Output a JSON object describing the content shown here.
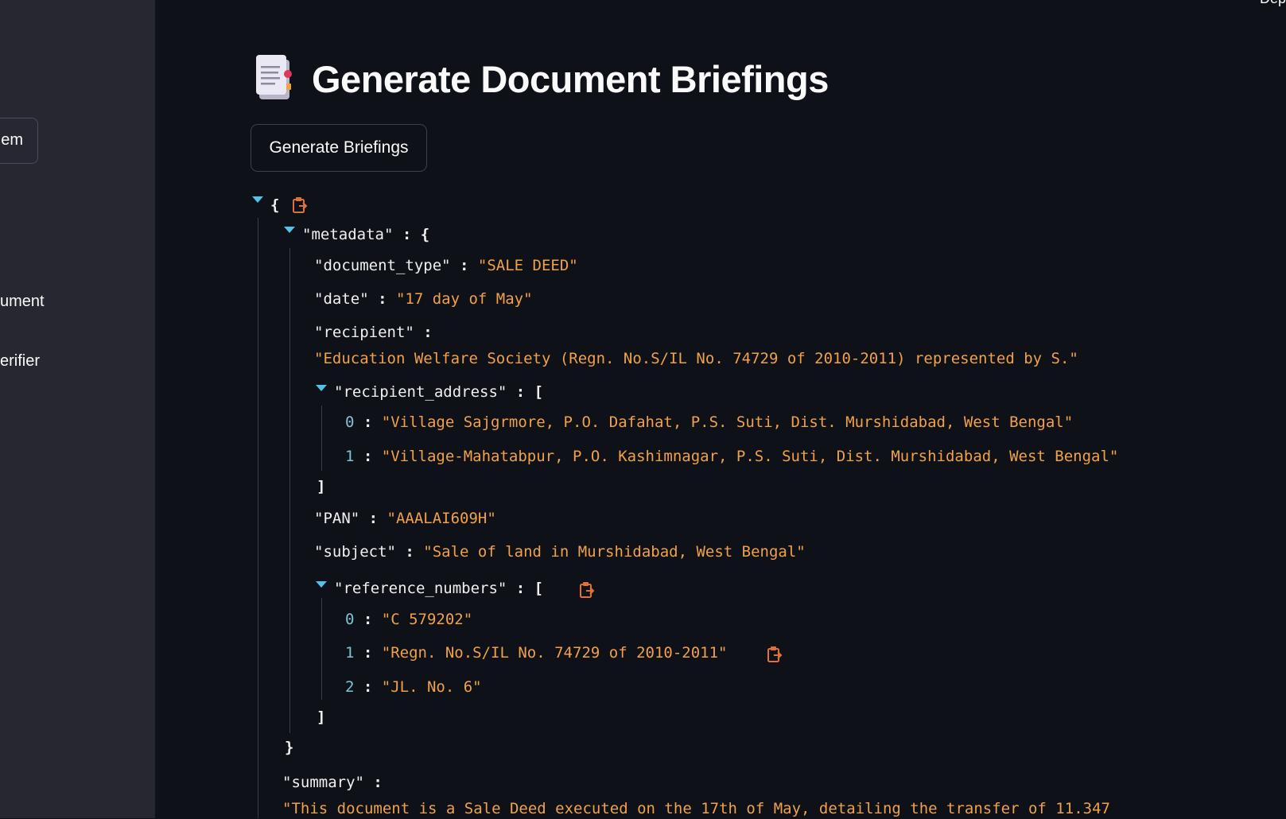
{
  "sidebar": {
    "partial_button_label": "em",
    "partial_links": [
      "ument",
      "erifier"
    ]
  },
  "top_right_partial": "Dep",
  "page": {
    "title": "Generate Document Briefings",
    "title_icon": "document-icon",
    "generate_button_label": "Generate Briefings"
  },
  "json_viewer": {
    "open_brace": "{",
    "metadata_key": "\"metadata\"",
    "document_type_key": "\"document_type\"",
    "document_type": "\"SALE DEED\"",
    "date_key": "\"date\"",
    "date": "\"17 day of May\"",
    "recipient_key": "\"recipient\"",
    "recipient": "\"Education Welfare Society (Regn. No.S/IL No. 74729 of 2010-2011) represented by S.\"",
    "recipient_address_key": "\"recipient_address\"",
    "recipient_address": [
      "\"Village Sajgrmore, P.O. Dafahat, P.S. Suti, Dist. Murshidabad, West Bengal\"",
      "\"Village-Mahatabpur, P.O. Kashimnagar, P.S. Suti, Dist. Murshidabad, West Bengal\""
    ],
    "pan_key": "\"PAN\"",
    "pan": "\"AAALAI609H\"",
    "subject_key": "\"subject\"",
    "subject": "\"Sale of land in Murshidabad, West Bengal\"",
    "reference_numbers_key": "\"reference_numbers\"",
    "reference_numbers": [
      "\"C 579202\"",
      "\"Regn. No.S/IL No. 74729 of 2010-2011\"",
      "\"JL. No. 6\""
    ],
    "summary_key": "\"summary\"",
    "summary": "\"This document is a Sale Deed executed on the 17th of May, detailing the transfer of 11.347"
  },
  "colors": {
    "background": "#0e1117",
    "sidebar": "#262730",
    "string": "#f0a14a",
    "index": "#7fc4d4",
    "toggle": "#4fc3e8"
  }
}
